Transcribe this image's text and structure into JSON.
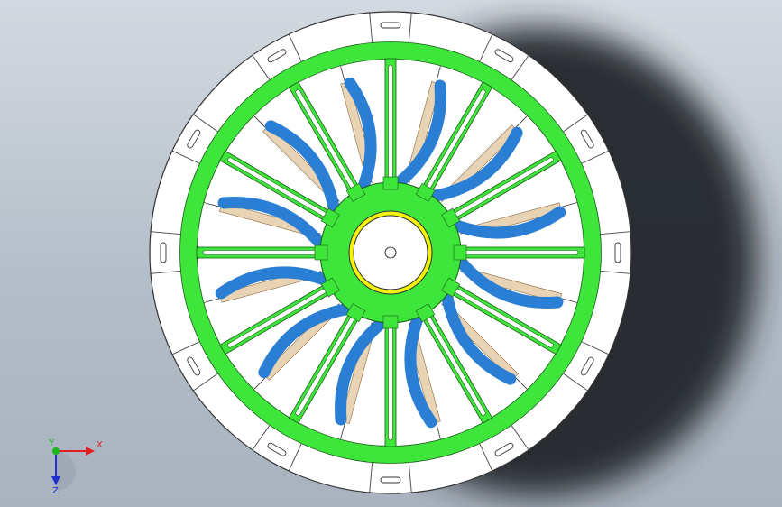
{
  "viewport": {
    "background_top": "#d3d9e0",
    "background_bottom": "#a9b3bf"
  },
  "model": {
    "spoke_count": 12,
    "colors": {
      "outer_disc": "#ffffff",
      "ring": "#3ee53a",
      "hub": "#3ee53a",
      "blade": "#2a7fd4",
      "bearing": "#f2f20a",
      "outline": "#222222",
      "rib": "#e8d4b4"
    }
  },
  "triad": {
    "x_label": "X",
    "y_label": "Y",
    "z_label": "Z",
    "x_color": "#e02020",
    "y_color": "#18b818",
    "z_color": "#2030d0"
  }
}
